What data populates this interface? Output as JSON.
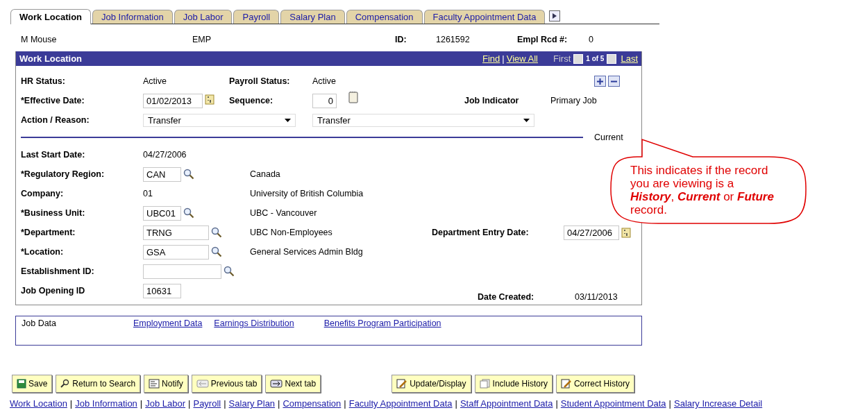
{
  "tabs": [
    {
      "label": "Work Location",
      "selected": true
    },
    {
      "label": "Job Information",
      "selected": false
    },
    {
      "label": "Job Labor",
      "selected": false
    },
    {
      "label": "Payroll",
      "selected": false
    },
    {
      "label": "Salary Plan",
      "selected": false
    },
    {
      "label": "Compensation",
      "selected": false
    },
    {
      "label": "Faculty Appointment Data",
      "selected": false
    }
  ],
  "header": {
    "name": "M Mouse",
    "type": "EMP",
    "id_label": "ID:",
    "id": "1261592",
    "rcd_label": "Empl Rcd #:",
    "rcd": "0"
  },
  "panel": {
    "title": "Work Location",
    "find": "Find",
    "separator": "|",
    "view_all": "View All",
    "first": "First",
    "count": "1 of 5",
    "last": "Last"
  },
  "status": {
    "hr_label": "HR Status:",
    "hr": "Active",
    "payroll_label": "Payroll Status:",
    "payroll": "Active"
  },
  "effective": {
    "date_label": "*Effective Date:",
    "date": "01/02/2013",
    "sequence_label": "Sequence:",
    "sequence": "0",
    "indicator_label": "Job Indicator",
    "indicator": "Primary Job"
  },
  "action": {
    "label": "Action / Reason:",
    "action": "Transfer",
    "reason": "Transfer"
  },
  "record_state": "Current",
  "last_start": {
    "label": "Last Start Date:",
    "value": "04/27/2006"
  },
  "fields": [
    {
      "label": "*Regulatory Region:",
      "kind": "lookup",
      "value": "CAN",
      "description": "Canada"
    },
    {
      "label": "Company:",
      "kind": "text",
      "value": "01",
      "description": "University of British Columbia"
    },
    {
      "label": "*Business Unit:",
      "kind": "lookup",
      "value": "UBC01",
      "description": "UBC - Vancouver"
    },
    {
      "label": "*Department:",
      "kind": "lookup",
      "value": "TRNG",
      "description": "UBC Non-Employees"
    },
    {
      "label": "*Location:",
      "kind": "lookup",
      "value": "GSA",
      "description": "General Services Admin Bldg"
    },
    {
      "label": "Establishment ID:",
      "kind": "lookup"
    },
    {
      "label": "Job Opening ID",
      "kind": "input",
      "value": "10631"
    }
  ],
  "dept_entry": {
    "label": "Department Entry Date:",
    "value": "04/27/2006"
  },
  "date_created": {
    "label": "Date Created:",
    "value": "03/11/2013"
  },
  "callout": "This indicates if the record you are viewing is a **History**, **Current** or **Future** record.",
  "related": {
    "label": "Job Data",
    "links": [
      "Employment Data",
      "Earnings Distribution",
      "Benefits Program Participation"
    ]
  },
  "buttons_left": [
    "Save",
    "Return to Search",
    "Notify",
    "Previous tab",
    "Next tab"
  ],
  "buttons_right": [
    "Update/Display",
    "Include History",
    "Correct History"
  ],
  "footer_links": [
    {
      "label": "Work Location"
    },
    {
      "separator": "|",
      "label": "Job Information"
    },
    {
      "separator": "|",
      "label": "Job Labor"
    },
    {
      "separator": "|",
      "label": "Payroll"
    },
    {
      "separator": "|",
      "label": "Salary Plan"
    },
    {
      "separator": "|",
      "label": "Compensation"
    },
    {
      "separator": "|",
      "label": "Faculty Appointment Data"
    },
    {
      "separator": "|",
      "label": "Staff Appointment Data"
    },
    {
      "separator": "|",
      "label": "Student Appointment Data"
    },
    {
      "separator": "|",
      "label": "Salary Increase Detail"
    }
  ]
}
